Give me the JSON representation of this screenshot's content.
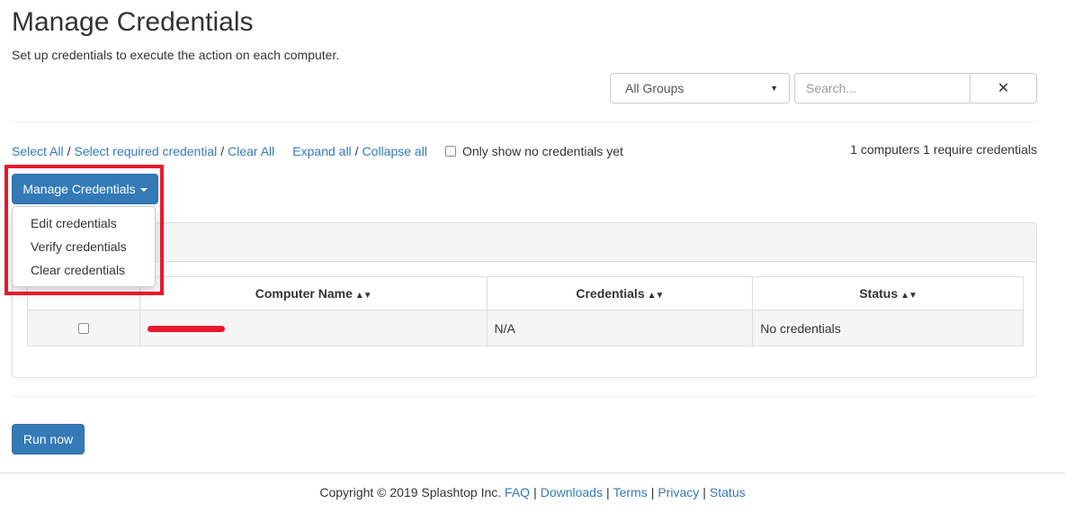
{
  "header": {
    "title": "Manage Credentials",
    "subtitle": "Set up credentials to execute the action on each computer."
  },
  "filters": {
    "group_selected": "All Groups",
    "search_placeholder": "Search...",
    "clear_symbol": "✕"
  },
  "toolbar": {
    "select_all": "Select All",
    "select_required": "Select required credential",
    "clear_all": "Clear All",
    "expand_all": "Expand all",
    "collapse_all": "Collapse all",
    "separator": "/",
    "only_show_label": "Only show no credentials yet",
    "summary": "1 computers 1 require credentials"
  },
  "manage_menu": {
    "button_label": "Manage Credentials",
    "items": [
      {
        "label": "Edit credentials"
      },
      {
        "label": "Verify credentials"
      },
      {
        "label": "Clear credentials"
      }
    ]
  },
  "table": {
    "columns": [
      {
        "label": "Computer Name"
      },
      {
        "label": "Credentials"
      },
      {
        "label": "Status"
      }
    ],
    "sort_symbol": "▲▼",
    "rows": [
      {
        "credentials": "N/A",
        "status": "No credentials"
      }
    ]
  },
  "actions": {
    "run_now": "Run now"
  },
  "footer": {
    "copyright": "Copyright © 2019 Splashtop Inc.",
    "links": [
      {
        "label": "FAQ"
      },
      {
        "label": "Downloads"
      },
      {
        "label": "Terms"
      },
      {
        "label": "Privacy"
      },
      {
        "label": "Status"
      }
    ],
    "separator": "|"
  },
  "colors": {
    "primary": "#337ab7",
    "highlight": "#e8192c"
  }
}
